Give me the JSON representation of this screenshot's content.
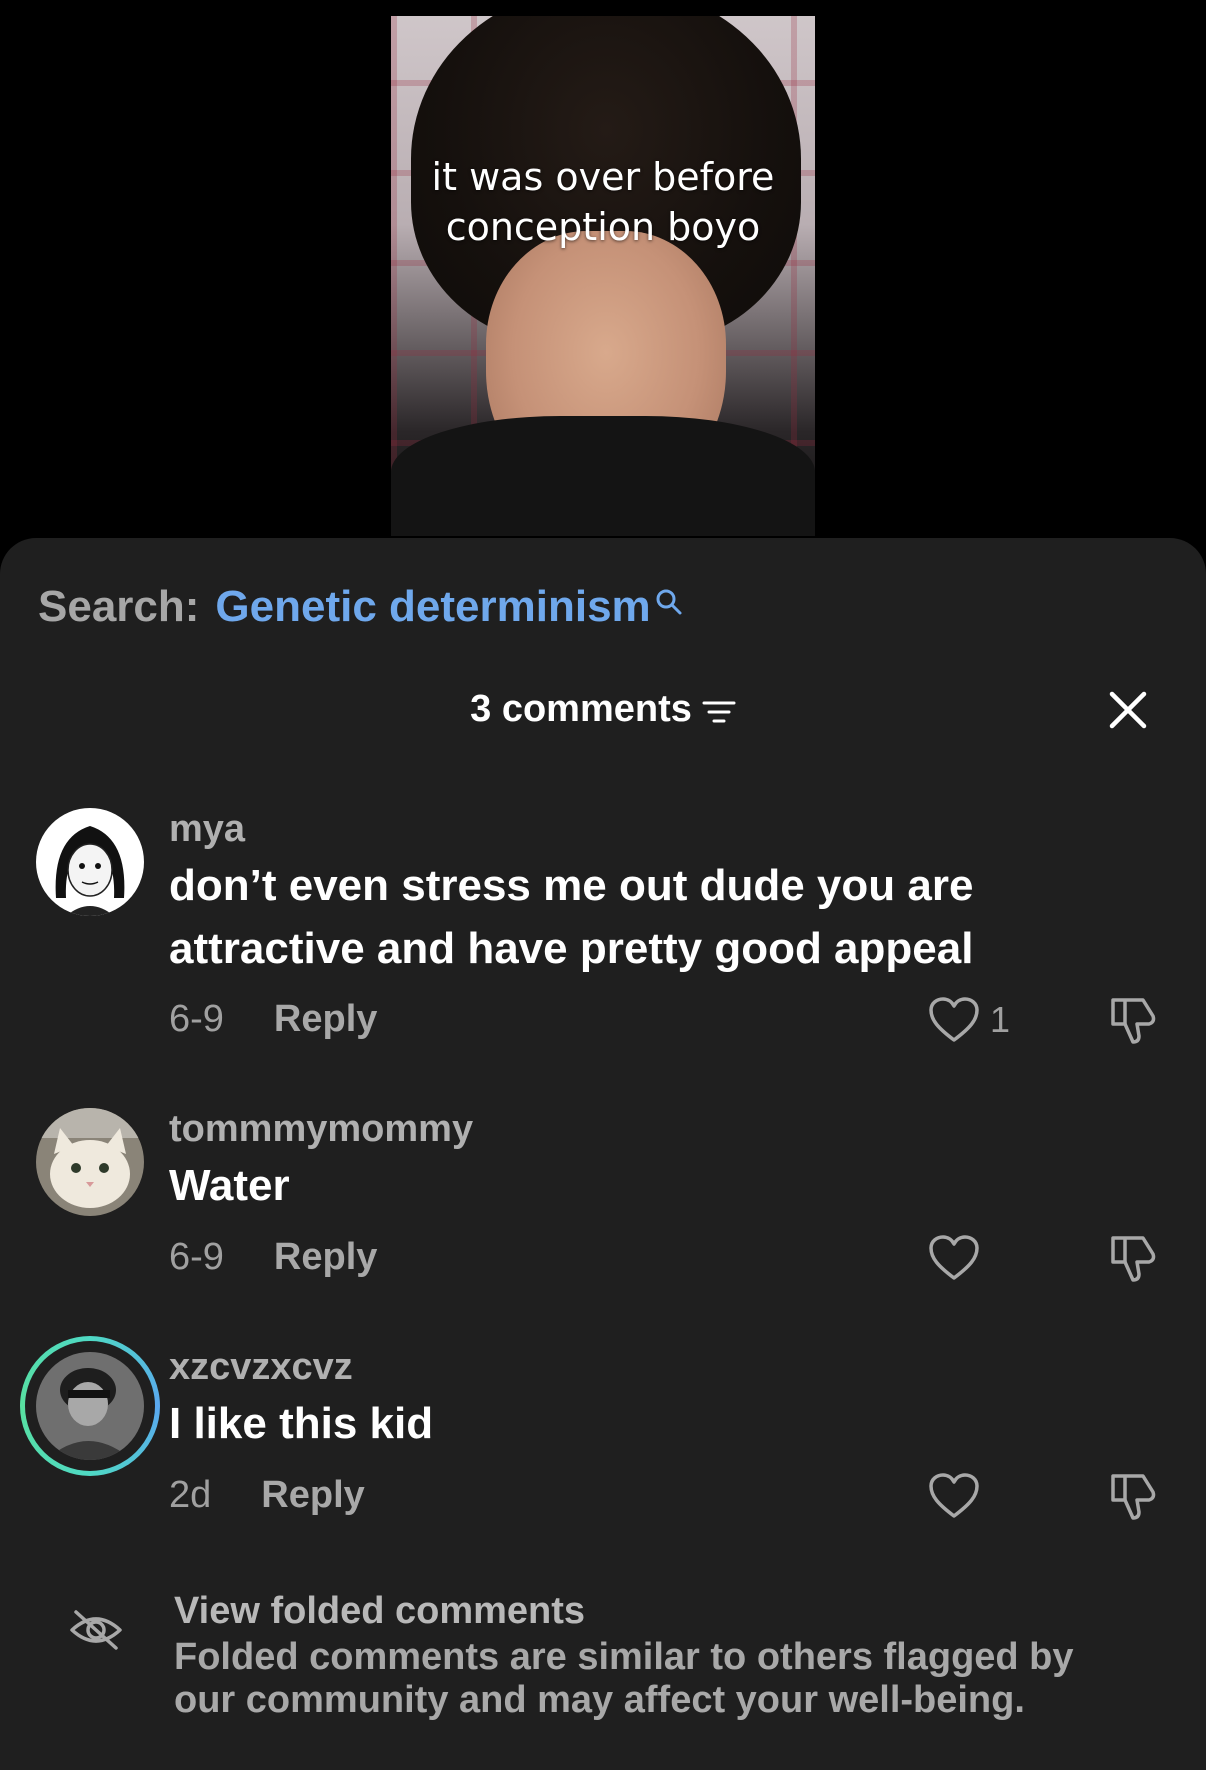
{
  "video": {
    "caption": "it was over before conception boyo"
  },
  "search": {
    "label": "Search:",
    "term": "Genetic determinism",
    "icon": "search-icon",
    "accent_color": "#6fa8ec"
  },
  "header": {
    "comment_count": "3 comments",
    "sort_icon": "sort-filter-icon",
    "close_icon": "close-icon"
  },
  "comments": [
    {
      "username": "mya",
      "text": "don’t even stress me out dude you are attractive and have pretty good appeal",
      "date": "6-9",
      "reply_label": "Reply",
      "like_count": "1"
    },
    {
      "username": "tommmymommy",
      "text": "Water",
      "date": "6-9",
      "reply_label": "Reply",
      "like_count": ""
    },
    {
      "username": "xzcvzxcvz",
      "text": "I like this kid",
      "date": "2d",
      "reply_label": "Reply",
      "like_count": ""
    }
  ],
  "folded": {
    "title": "View folded comments",
    "description": "Folded comments are similar to others flagged by our community and may affect your well-being.",
    "icon": "eye-slash-icon"
  }
}
